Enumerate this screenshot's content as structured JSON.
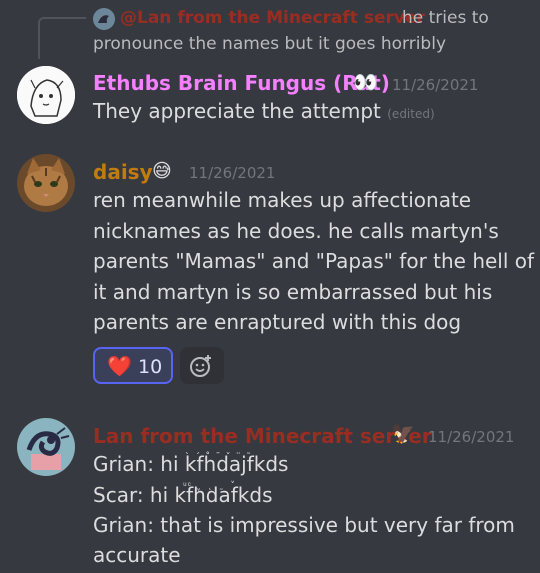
{
  "reply": {
    "author": "@Lan from the Minecraft server",
    "text_line1": "he tries to",
    "text_line2": "pronounce the names but it goes horribly"
  },
  "messages": [
    {
      "author": "Ethubs Brain Fungus (Rat)",
      "author_color": "#f47fff",
      "badge": "👀",
      "timestamp": "11/26/2021",
      "lines": [
        "They appreciate the attempt"
      ],
      "edited": "(edited)"
    },
    {
      "author": "daisy",
      "author_color": "#c27c0e",
      "badge": "😅",
      "timestamp": "11/26/2021",
      "lines": [
        "ren meanwhile makes up affectionate",
        "nicknames as he does. he calls martyn's",
        "parents \"Mamas\" and \"Papas\" for the hell of",
        "it and martyn is so embarrassed but his",
        "parents are enraptured with this dog"
      ],
      "reaction": {
        "emoji": "❤️",
        "count": "10"
      }
    },
    {
      "author": "Lan from the Minecraft server",
      "author_color": "#992d22",
      "badge": "🦅",
      "timestamp": "11/26/2021",
      "lines": [
        "Grian: hi",
        "Scar: hi kfhdafkds",
        "Grian: that is impressive but very far from",
        "accurate"
      ],
      "glitch_text": "kfhdajfkds"
    }
  ]
}
